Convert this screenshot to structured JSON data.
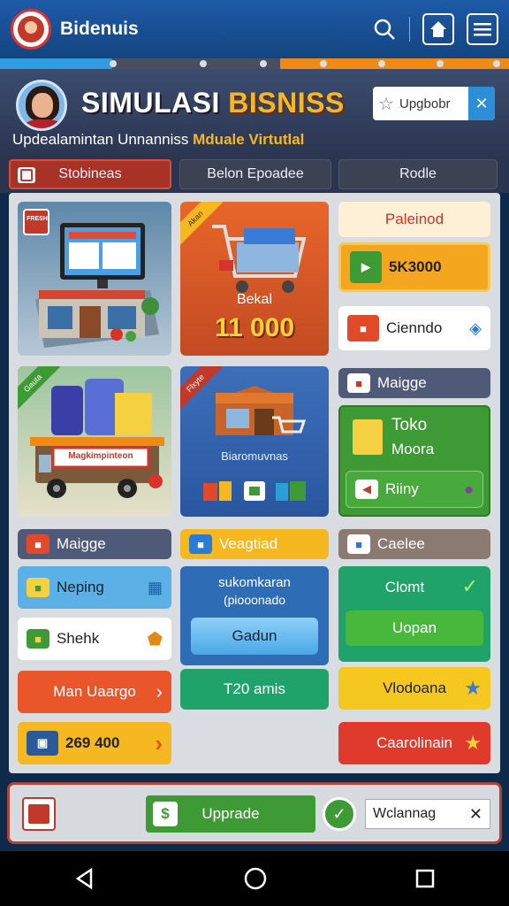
{
  "app": {
    "name": "Bidenuis"
  },
  "header": {
    "title_part1": "SIMULASI",
    "title_part2": "BISNISS",
    "subtitle_part1": "Updealamintan Unnanniss",
    "subtitle_part2": "Mduale Virtutlal",
    "upgrade_label": "Upgbobr",
    "close_symbol": "✕"
  },
  "tabs": [
    {
      "label": "Stobineas",
      "active": true
    },
    {
      "label": "Belon Epoadee",
      "active": false
    },
    {
      "label": "Rodle",
      "active": false
    }
  ],
  "cards": {
    "market": {
      "tag": "FRESH"
    },
    "shop_cart": {
      "tag": "Akan",
      "label": "Bekal",
      "value": "11 000"
    },
    "truck": {
      "tag": "Gauta",
      "banner": "Magkimpinteon"
    },
    "store": {
      "tag": "Flxyte",
      "label": "Biaromuvnas"
    }
  },
  "right_col": {
    "pending_label": "Paleinod",
    "amount_label": "5K3000",
    "client_label": "Cienndo",
    "maigge_label": "Maigge",
    "toko_line1": "Toko",
    "toko_line2": "Moora",
    "riiny_label": "Riiny"
  },
  "section_headers": {
    "left": "Maigge",
    "middle": "Veagtiad",
    "right": "Caelee"
  },
  "buttons": {
    "neping": "Neping",
    "sheh": "Shehk",
    "man_uaargo": "Man Uaargo",
    "counter": "269 400",
    "promo_line1": "sukomkaran",
    "promo_line2": "(piooonado",
    "gadun": "Gadun",
    "t20": "T20 amis",
    "clomt": "Clomt",
    "uopan": "Uopan",
    "vlodoana": "Vlodoana",
    "caarolinain": "Caarolinain"
  },
  "bottombar": {
    "upgrade": "Upprade",
    "welcome": "Wclannag",
    "close_symbol": "✕"
  },
  "colors": {
    "accent_blue": "#1e5aa8",
    "accent_orange": "#f08a16",
    "accent_gold": "#f5b820",
    "tab_active": "#a83226",
    "green": "#3e9a34",
    "red": "#e03a2c"
  }
}
